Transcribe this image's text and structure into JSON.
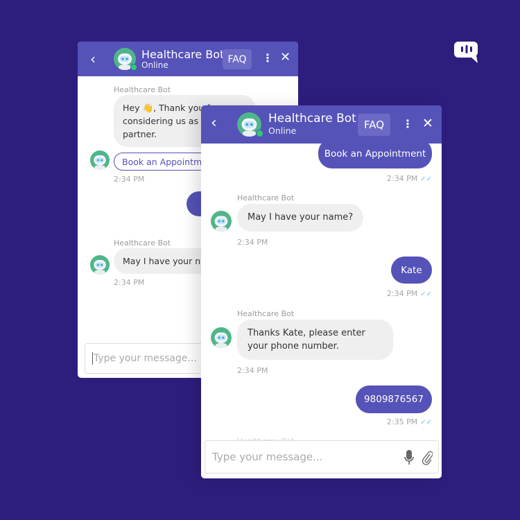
{
  "brand": {
    "logo_icon": "chat-bubble-logo-icon"
  },
  "colors": {
    "background": "#2d1e7e",
    "header": "#5552b8",
    "user_bubble": "#5552b8",
    "online": "#2ecc71"
  },
  "back_window": {
    "header": {
      "title": "Healthcare Bot",
      "status": "Online",
      "faq": "FAQ"
    },
    "messages": [
      {
        "sender": "Healthcare Bot",
        "text": "Hey 👋, Thank you for considering us as your care partner."
      },
      {
        "button": "Book an Appointment",
        "time": "2:34 PM"
      },
      {
        "user": "B"
      },
      {
        "sender": "Healthcare Bot",
        "text": "May I have your name?",
        "time": "2:34 PM"
      }
    ],
    "input_placeholder": "Type your message..."
  },
  "front_window": {
    "header": {
      "title": "Healthcare Bot",
      "status": "Online",
      "faq": "FAQ"
    },
    "messages": [
      {
        "text": "Book an Appointment",
        "time": "2:34 PM"
      },
      {
        "sender": "Healthcare Bot",
        "text": "May I have your name?",
        "time": "2:34 PM"
      },
      {
        "text": "Kate",
        "time": "2:34 PM"
      },
      {
        "sender": "Healthcare Bot",
        "text": "Thanks Kate, please enter your phone number.",
        "time": "2:34 PM"
      },
      {
        "text": "9809876567",
        "time": "2:35 PM"
      },
      {
        "sender": "Healthcare Bot"
      }
    ],
    "input_placeholder": "Type your message..."
  }
}
